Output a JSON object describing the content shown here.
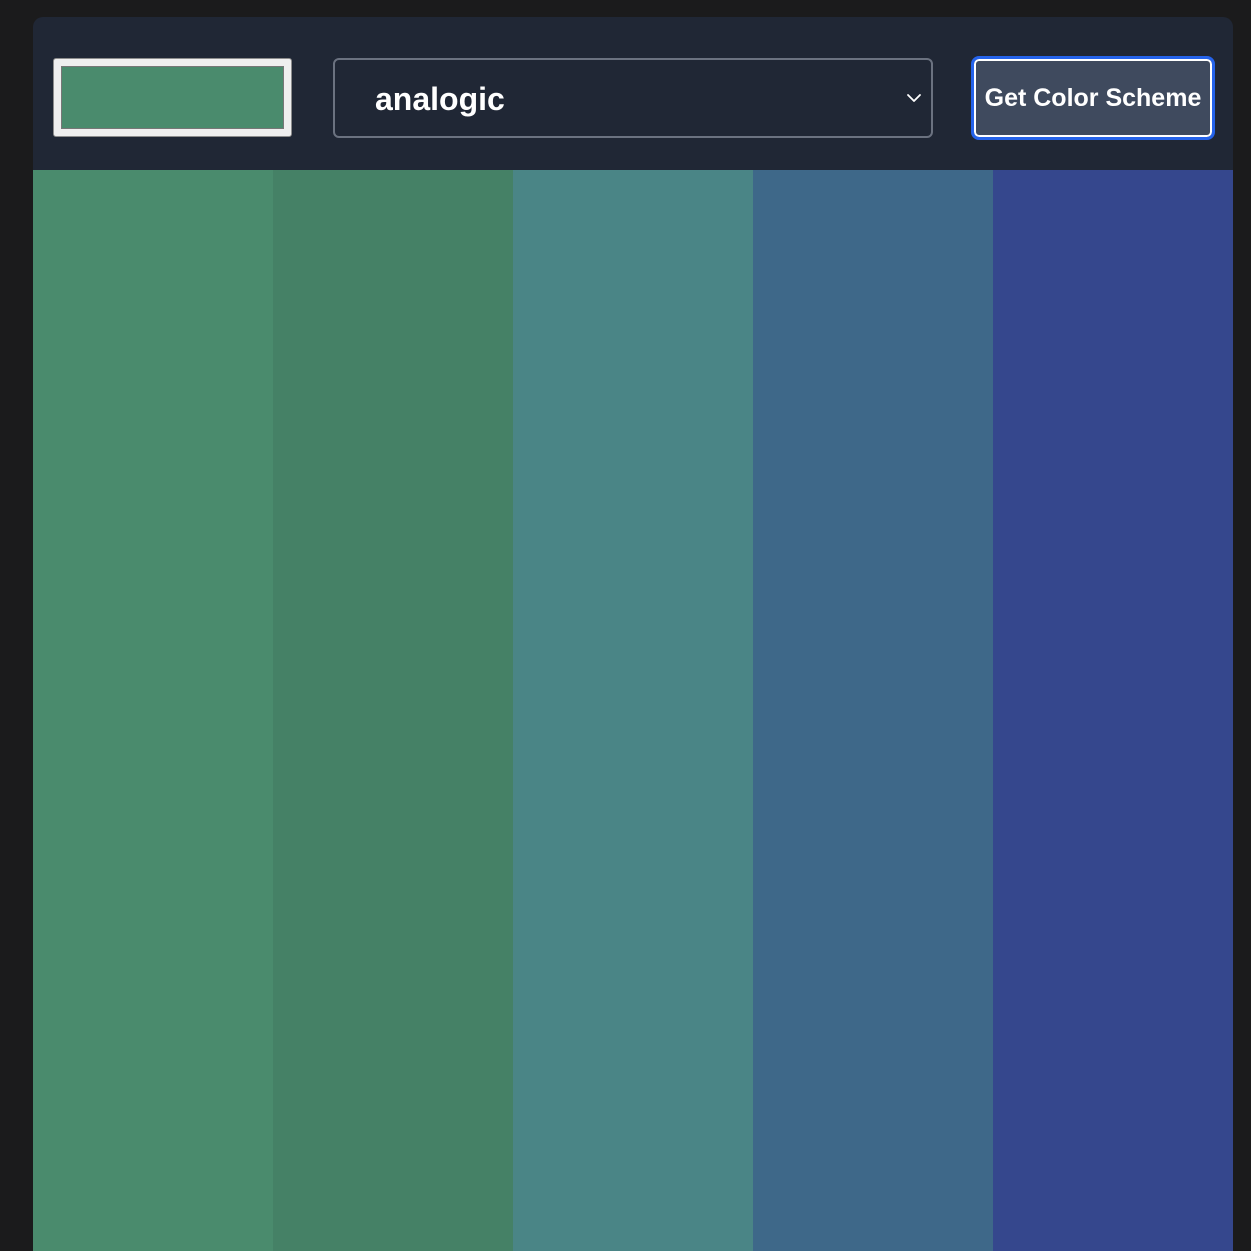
{
  "seed": {
    "color": "#4a8b6d"
  },
  "mode_select": {
    "selected": "analogic"
  },
  "actions": {
    "get_scheme_label": "Get Color Scheme"
  },
  "palette": {
    "colors": [
      "#4a8b6d",
      "#458166",
      "#4a8586",
      "#3e6889",
      "#35478d"
    ]
  }
}
